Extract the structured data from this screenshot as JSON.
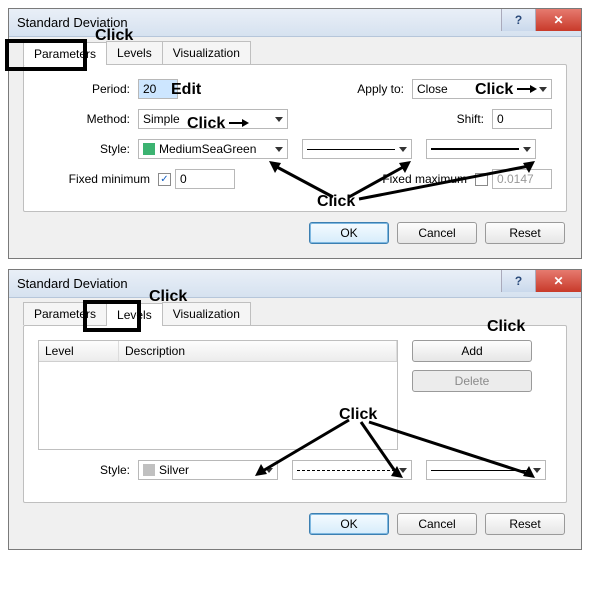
{
  "dialog1": {
    "title": "Standard Deviation",
    "tabs": [
      "Parameters",
      "Levels",
      "Visualization"
    ],
    "active_tab": 0,
    "fields": {
      "period_label": "Period:",
      "period_value": "20",
      "applyto_label": "Apply to:",
      "applyto_value": "Close",
      "method_label": "Method:",
      "method_value": "Simple",
      "shift_label": "Shift:",
      "shift_value": "0",
      "style_label": "Style:",
      "style_color_name": "MediumSeaGreen",
      "style_color_hex": "#3cb371",
      "fixed_min_label": "Fixed minimum",
      "fixed_min_checked": true,
      "fixed_min_value": "0",
      "fixed_max_label": "Fixed maximum",
      "fixed_max_checked": false,
      "fixed_max_value": "0.0147"
    },
    "buttons": {
      "ok": "OK",
      "cancel": "Cancel",
      "reset": "Reset"
    }
  },
  "dialog2": {
    "title": "Standard Deviation",
    "tabs": [
      "Parameters",
      "Levels",
      "Visualization"
    ],
    "active_tab": 1,
    "grid": {
      "col_level": "Level",
      "col_desc": "Description"
    },
    "buttons_side": {
      "add": "Add",
      "delete": "Delete"
    },
    "style_label": "Style:",
    "style_color_name": "Silver",
    "style_color_hex": "#c0c0c0",
    "buttons": {
      "ok": "OK",
      "cancel": "Cancel",
      "reset": "Reset"
    }
  },
  "annotations": {
    "click": "Click",
    "edit": "Edit"
  }
}
